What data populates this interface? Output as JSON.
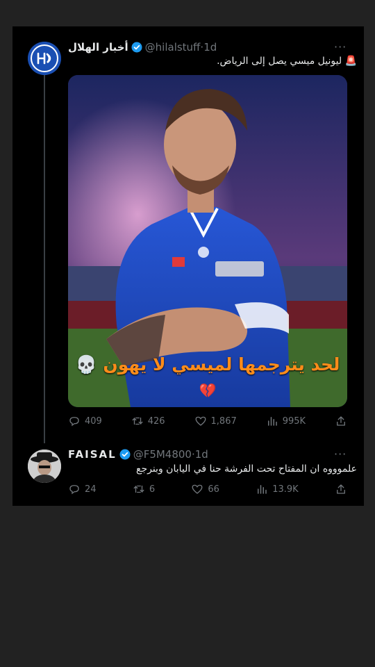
{
  "tweet1": {
    "name": "أخبار الهلال",
    "handle": "@hilalstuff",
    "time": "1d",
    "text": "🚨 ليونيل ميسي يصل إلى الرياض.",
    "more": "···",
    "image": {
      "overlay_caption": "لحد يترجمها لميسي لا يهون 💀",
      "overlay_emoji": "💔"
    },
    "stats": {
      "replies": "409",
      "retweets": "426",
      "likes": "1,867",
      "views": "995K"
    }
  },
  "tweet2": {
    "name": "FAISAL",
    "handle": "@F5M4800",
    "time": "1d",
    "text": "علموووه ان المفتاح تحت الفرشة  حنا في اليابان وبنرجع",
    "more": "···",
    "stats": {
      "replies": "24",
      "retweets": "6",
      "likes": "66",
      "views": "13.9K"
    }
  },
  "colors": {
    "background": "#222222",
    "card": "#000000",
    "muted": "#71767b",
    "verified": "#1d9bf0",
    "caption": "#ff8c1a",
    "hilal_blue": "#1a4fb3"
  }
}
